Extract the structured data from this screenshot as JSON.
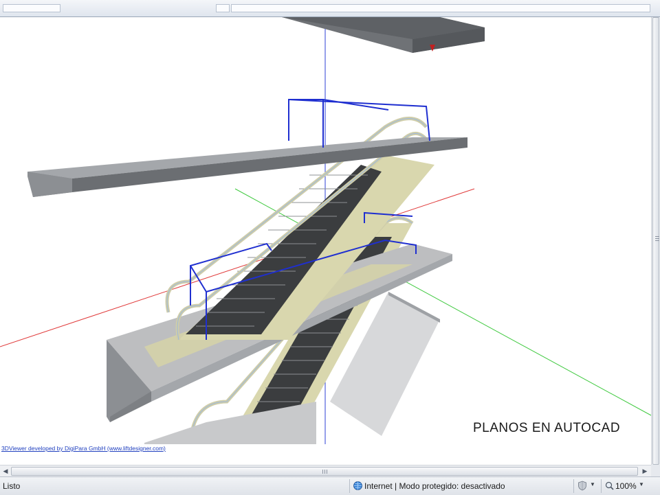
{
  "viewer": {
    "overlay_title": "PLANOS EN AUTOCAD",
    "credit": "3DViewer developed by DigiPara GmbH (www.liftdesigner.com)"
  },
  "statusbar": {
    "status": "Listo",
    "zone": "Internet | Modo protegido: desactivado",
    "zoom": "100%"
  },
  "icons": {
    "zone": "globe-icon",
    "security": "security-shield-icon",
    "zoom": "zoom-icon"
  },
  "colors": {
    "axis_x": "#e03a3a",
    "axis_y": "#3ec93e",
    "axis_z": "#2b3fd6",
    "slab": "#8d9095",
    "truss": "#d8d6b4",
    "balustrade_frame": "#1f2fd0"
  }
}
